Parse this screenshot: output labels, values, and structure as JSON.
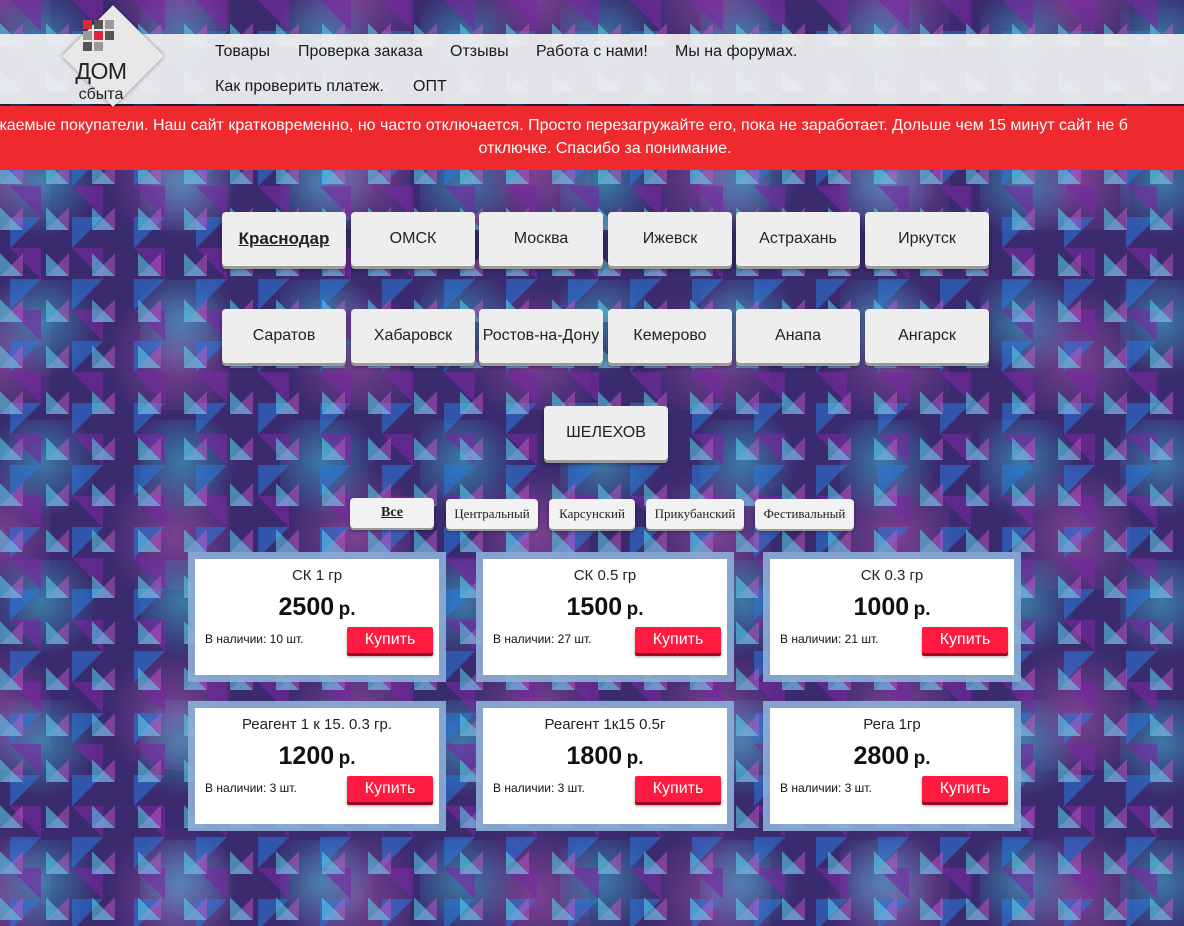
{
  "logo": {
    "title": "ДОМ",
    "subtitle": "сбыта",
    "colors": [
      "#d9283a",
      "#555555",
      "#9a9a9a"
    ]
  },
  "nav": {
    "items": [
      "Товары",
      "Проверка заказа",
      "Отзывы",
      "Работа с нами!",
      "Мы на форумах.",
      "Как проверить платеж.",
      "ОПТ"
    ]
  },
  "banner": {
    "line1": "жаемые покупатели. Наш сайт кратковременно, но часто отключается. Просто перезагружайте его, пока не заработает. Дольше чем 15 минут сайт не б",
    "line2": "отключке. Спасибо за понимание.",
    "color": "#ee2a2e"
  },
  "cities": {
    "selected": "Краснодар",
    "items": [
      "Краснодар",
      "ОМСК",
      "Москва",
      "Ижевск",
      "Астрахань",
      "Иркутск",
      "Саратов",
      "Хабаровск",
      "Ростов-на-Дону",
      "Кемерово",
      "Анапа",
      "Ангарск",
      "ШЕЛЕХОВ"
    ]
  },
  "districts": {
    "selected": "Все",
    "items": [
      "Все",
      "Центральный",
      "Карсунский",
      "Прикубанский",
      "Фестивальный"
    ]
  },
  "products": [
    {
      "name": "СК 1 гр",
      "price": "2500",
      "currency": "р.",
      "stock": "В наличии: 10 шт.",
      "buy": "Купить"
    },
    {
      "name": "СК 0.5 гр",
      "price": "1500",
      "currency": "р.",
      "stock": "В наличии: 27 шт.",
      "buy": "Купить"
    },
    {
      "name": "СК 0.3 гр",
      "price": "1000",
      "currency": "р.",
      "stock": "В наличии: 21 шт.",
      "buy": "Купить"
    },
    {
      "name": "Реагент 1 к 15. 0.3 гр.",
      "price": "1200",
      "currency": "р.",
      "stock": "В наличии: 3 шт.",
      "buy": "Купить"
    },
    {
      "name": "Реагент 1к15 0.5г",
      "price": "1800",
      "currency": "р.",
      "stock": "В наличии: 3 шт.",
      "buy": "Купить"
    },
    {
      "name": "Рега 1гр",
      "price": "2800",
      "currency": "р.",
      "stock": "В наличии: 3 шт.",
      "buy": "Купить"
    }
  ],
  "accent_buy": "#ff1a3f"
}
